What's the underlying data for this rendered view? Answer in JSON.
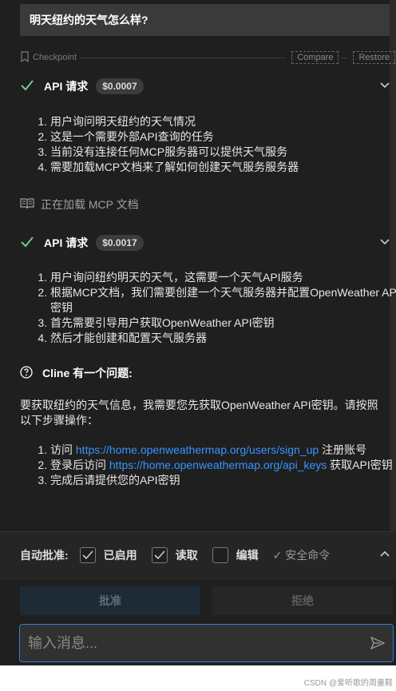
{
  "user_message": "明天纽约的天气怎么样?",
  "checkpoint": {
    "label": "Checkpoint",
    "compare": "Compare",
    "restore": "Restore"
  },
  "api_blocks": [
    {
      "title": "API 请求",
      "cost": "$0.0007",
      "items": [
        "用户询问明天纽约的天气情况",
        "这是一个需要外部API查询的任务",
        "当前没有连接任何MCP服务器可以提供天气服务",
        "需要加载MCP文档来了解如何创建天气服务服务器"
      ]
    },
    {
      "title": "API 请求",
      "cost": "$0.0017",
      "items": [
        "用户询问纽约明天的天气，这需要一个天气API服务",
        "根据MCP文档，我们需要创建一个天气服务器并配置OpenWeather API密钥",
        "首先需要引导用户获取OpenWeather API密钥",
        "然后才能创建和配置天气服务器"
      ]
    }
  ],
  "loading_text": "正在加载 MCP 文档",
  "question": {
    "title": "Cline 有一个问题:",
    "intro": "要获取纽约的天气信息，我需要您先获取OpenWeather API密钥。请按照以下步骤操作：",
    "steps": [
      {
        "prefix": "访问 ",
        "link": "https://home.openweathermap.org/users/sign_up",
        "suffix": " 注册账号"
      },
      {
        "prefix": "登录后访问 ",
        "link": "https://home.openweathermap.org/api_keys",
        "suffix": " 获取API密钥"
      },
      {
        "prefix": "完成后请提供您的API密钥",
        "link": "",
        "suffix": ""
      }
    ]
  },
  "auto_approve": {
    "label": "自动批准:",
    "options": [
      {
        "label": "已启用",
        "checked": true
      },
      {
        "label": "读取",
        "checked": true
      },
      {
        "label": "编辑",
        "checked": false
      }
    ],
    "safe_commands": "✓ 安全命令"
  },
  "buttons": {
    "approve": "批准",
    "reject": "拒绝"
  },
  "input": {
    "placeholder": "输入消息..."
  },
  "watermark": "CSDN @爱听歌的周童鞋",
  "colors": {
    "accent": "#3794ff",
    "check_green": "#73c991",
    "focus_border": "#2f7fd6"
  }
}
